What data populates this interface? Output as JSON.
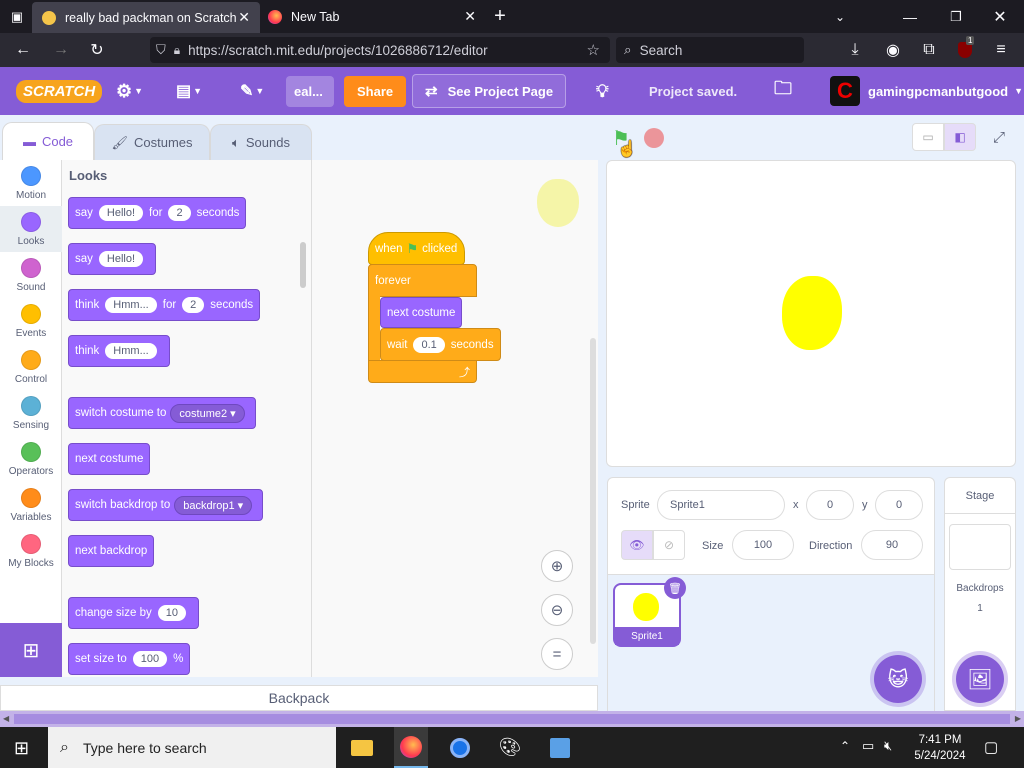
{
  "browser": {
    "tabs": [
      {
        "title": "really bad packman on Scratch",
        "active": true
      },
      {
        "title": "New Tab",
        "active": false
      }
    ],
    "url": "https://scratch.mit.edu/projects/1026886712/editor",
    "search_placeholder": "Search",
    "ext_badge": "1"
  },
  "menubar": {
    "logo": "SCRATCH",
    "project_title": "eal...",
    "share": "Share",
    "see_project": "See Project Page",
    "status": "Project saved.",
    "username": "gamingpcmanbutgood"
  },
  "editor_tabs": [
    "Code",
    "Costumes",
    "Sounds"
  ],
  "categories": [
    {
      "label": "Motion",
      "color": "#4c97ff"
    },
    {
      "label": "Looks",
      "color": "#9966ff"
    },
    {
      "label": "Sound",
      "color": "#cf63cf"
    },
    {
      "label": "Events",
      "color": "#ffbf00"
    },
    {
      "label": "Control",
      "color": "#ffab19"
    },
    {
      "label": "Sensing",
      "color": "#5cb1d6"
    },
    {
      "label": "Operators",
      "color": "#59c059"
    },
    {
      "label": "Variables",
      "color": "#ff8c1a"
    },
    {
      "label": "My Blocks",
      "color": "#ff6680"
    }
  ],
  "palette": {
    "heading": "Looks",
    "say_for": {
      "a": "say",
      "v1": "Hello!",
      "b": "for",
      "v2": "2",
      "c": "seconds"
    },
    "say": {
      "a": "say",
      "v1": "Hello!"
    },
    "think_for": {
      "a": "think",
      "v1": "Hmm...",
      "b": "for",
      "v2": "2",
      "c": "seconds"
    },
    "think": {
      "a": "think",
      "v1": "Hmm..."
    },
    "switch_costume": {
      "a": "switch costume to",
      "v1": "costume2"
    },
    "next_costume": "next costume",
    "switch_backdrop": {
      "a": "switch backdrop to",
      "v1": "backdrop1"
    },
    "next_backdrop": "next backdrop",
    "change_size": {
      "a": "change size by",
      "v1": "10"
    },
    "set_size": {
      "a": "set size to",
      "v1": "100",
      "b": "%"
    }
  },
  "script": {
    "when": "when",
    "clicked": "clicked",
    "forever": "forever",
    "next_costume": "next costume",
    "wait": "wait",
    "wait_val": "0.1",
    "seconds": "seconds"
  },
  "backpack": "Backpack",
  "sprite_info": {
    "sprite_label": "Sprite",
    "sprite_name": "Sprite1",
    "x_label": "x",
    "x": "0",
    "y_label": "y",
    "y": "0",
    "size_label": "Size",
    "size": "100",
    "direction_label": "Direction",
    "direction": "90"
  },
  "sprites": [
    {
      "name": "Sprite1"
    }
  ],
  "stage_panel": {
    "title": "Stage",
    "backdrops_label": "Backdrops",
    "backdrops_count": "1"
  },
  "taskbar": {
    "search_placeholder": "Type here to search",
    "time": "7:41 PM",
    "date": "5/24/2024"
  }
}
